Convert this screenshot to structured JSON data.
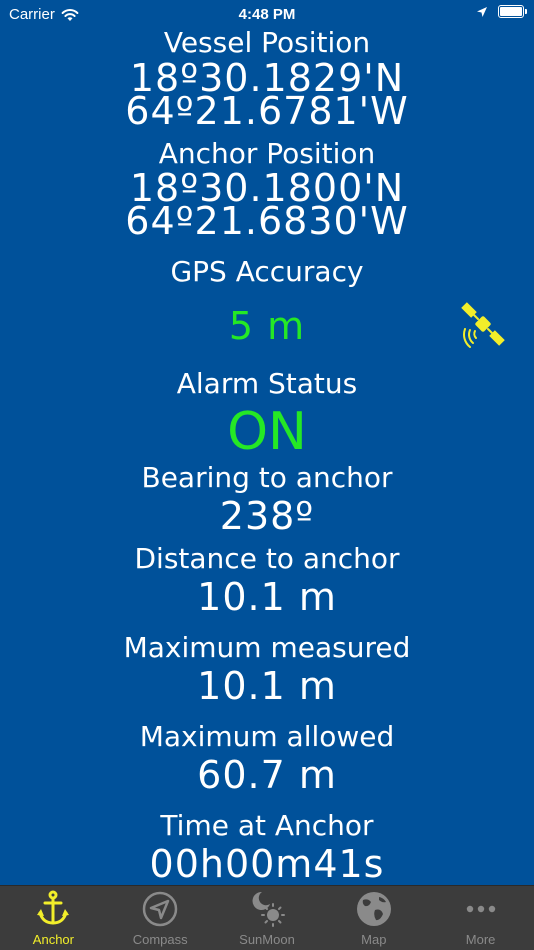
{
  "status_bar": {
    "carrier": "Carrier",
    "time": "4:48 PM"
  },
  "vessel": {
    "label": "Vessel Position",
    "lat": "18º30.1829'N",
    "lon": "64º21.6781'W"
  },
  "anchor": {
    "label": "Anchor Position",
    "lat": "18º30.1800'N",
    "lon": "64º21.6830'W"
  },
  "gps": {
    "label": "GPS Accuracy",
    "value": "5 m"
  },
  "alarm": {
    "label": "Alarm Status",
    "value": "ON"
  },
  "bearing": {
    "label": "Bearing to anchor",
    "value": "238º"
  },
  "distance": {
    "label": "Distance to anchor",
    "value": "10.1 m"
  },
  "max_measured": {
    "label": "Maximum measured",
    "value": "10.1 m"
  },
  "max_allowed": {
    "label": "Maximum allowed",
    "value": "60.7 m"
  },
  "time_at_anchor": {
    "label": "Time at Anchor",
    "value": "00h00m41s"
  },
  "colors": {
    "background": "#00519A",
    "accent": "#f2ee2a",
    "ok": "#25e825",
    "tab_bg": "#3c3c3c"
  },
  "tabs": [
    {
      "label": "Anchor",
      "icon": "anchor-icon",
      "active": true
    },
    {
      "label": "Compass",
      "icon": "compass-icon",
      "active": false
    },
    {
      "label": "SunMoon",
      "icon": "sun-moon-icon",
      "active": false
    },
    {
      "label": "Map",
      "icon": "globe-icon",
      "active": false
    },
    {
      "label": "More",
      "icon": "more-icon",
      "active": false
    }
  ]
}
